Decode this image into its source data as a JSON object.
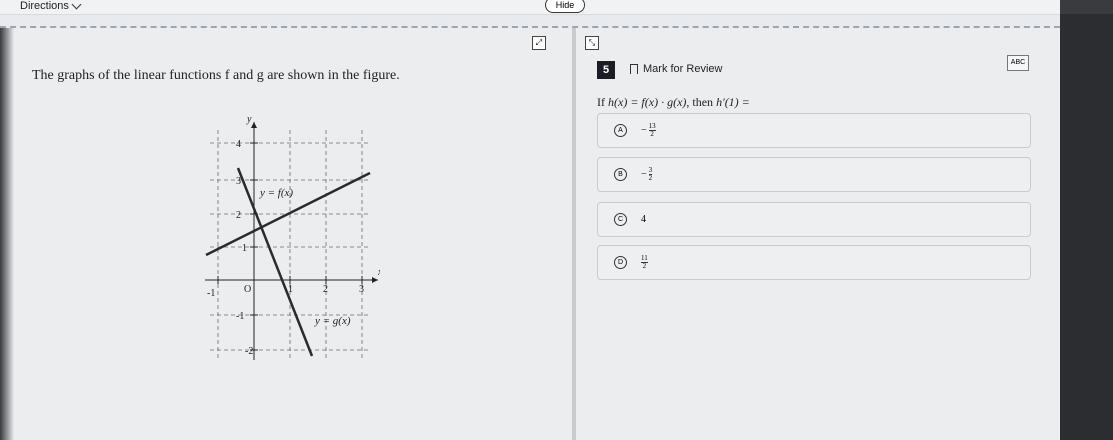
{
  "header": {
    "directions_label": "Directions",
    "hide_label": "Hide"
  },
  "left": {
    "prompt": "The graphs of the linear functions f and g are shown in the figure."
  },
  "graph": {
    "y_label": "y",
    "x_label": "x",
    "origin_label": "O",
    "x_ticks": [
      "-1",
      "1",
      "2",
      "3"
    ],
    "y_ticks": [
      "4",
      "3",
      "2",
      "1",
      "-1",
      "-2"
    ],
    "f_label": "y = f(x)",
    "g_label": "y = g(x)"
  },
  "question": {
    "number": "5",
    "mark_label": "Mark for Review",
    "abc_label": "ABC",
    "text_prefix": "If",
    "text_func": "h(x) = f(x) · g(x)",
    "text_mid": ", then",
    "text_deriv": "h′(1) ="
  },
  "choices": [
    {
      "letter": "A",
      "sign": "−",
      "num": "13",
      "den": "2"
    },
    {
      "letter": "B",
      "sign": "−",
      "num": "3",
      "den": "2"
    },
    {
      "letter": "C",
      "value": "4"
    },
    {
      "letter": "D",
      "num": "11",
      "den": "2"
    }
  ]
}
